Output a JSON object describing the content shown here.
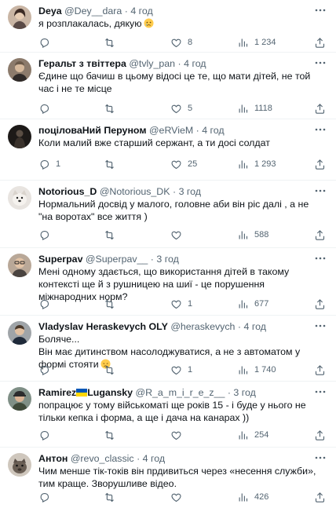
{
  "tweets": [
    {
      "name": "Deya",
      "handle": "@Dey__dara",
      "time": "4 год",
      "text": "я розплакалась, дякую",
      "replies": "",
      "retweets": "",
      "likes": "8",
      "views": "1 234",
      "avatar_icon": "avatar-woman-photo"
    },
    {
      "name": "Геральт з твіттера",
      "handle": "@tvly_pan",
      "time": "4 год",
      "text": "Єдине що бачиш в цьому відосі це те, що мати дітей, не той час і не те місце",
      "replies": "",
      "retweets": "",
      "likes": "5",
      "views": "1118",
      "avatar_icon": "avatar-man-photo"
    },
    {
      "name": "поціловаНий Перуном",
      "handle": "@eRVieM",
      "time": "4 год",
      "text": "Коли малий вже старший сержант, а ти досі солдат",
      "replies": "1",
      "retweets": "",
      "likes": "25",
      "views": "1 293",
      "avatar_icon": "avatar-dark-figure"
    },
    {
      "name": "Notorious_D",
      "handle": "@Notorious_DK",
      "time": "3 год",
      "text": "Нормальний досвід у малого, головне аби він ріс далі , а не \"на воротах\" все життя )",
      "replies": "",
      "retweets": "",
      "likes": "",
      "views": "588",
      "avatar_icon": "avatar-dog-photo"
    },
    {
      "name": "Superpav",
      "handle": "@Superpav__",
      "time": "3 год",
      "text": "Мені одному здається, що використання дітей в такому контексті ще й з рушницею на шиї - це порушення міжнародних норм?",
      "replies": "",
      "retweets": "",
      "likes": "1",
      "views": "677",
      "avatar_icon": "avatar-glasses-photo"
    },
    {
      "name": "Vladyslav Heraskevych OLY",
      "handle": "@heraskevych",
      "time": "4 год",
      "text": "Боляче...\nВін має дитинством насолоджуватися, а не з автоматом у формі стояти",
      "replies": "",
      "retweets": "",
      "likes": "1",
      "views": "1 740",
      "avatar_icon": "avatar-man-photo"
    },
    {
      "name": "Ramirez",
      "name_suffix": "Lugansky",
      "handle": "@R_a_m_i_r_e_z__",
      "time": "3 год",
      "text": "попрацює у тому військоматі ще років 15 - і буде у нього не тільки кепка і форма, а ще і дача на канарах ))",
      "replies": "",
      "retweets": "",
      "likes": "",
      "views": "254",
      "avatar_icon": "avatar-man-cap-photo"
    },
    {
      "name": "Антон",
      "handle": "@revo_classic",
      "time": "4 год",
      "text": "Чим менше тік-токів він прдивиться через «несення служби», тим краще. Зворушливе відео.",
      "replies": "",
      "retweets": "",
      "likes": "",
      "views": "426",
      "avatar_icon": "avatar-animal-photo"
    }
  ],
  "separator": "·",
  "colors": {
    "text": "#0f1419",
    "muted": "#536471",
    "border": "#eff3f4",
    "flag_blue": "#0057b7",
    "flag_yellow": "#ffd700"
  }
}
